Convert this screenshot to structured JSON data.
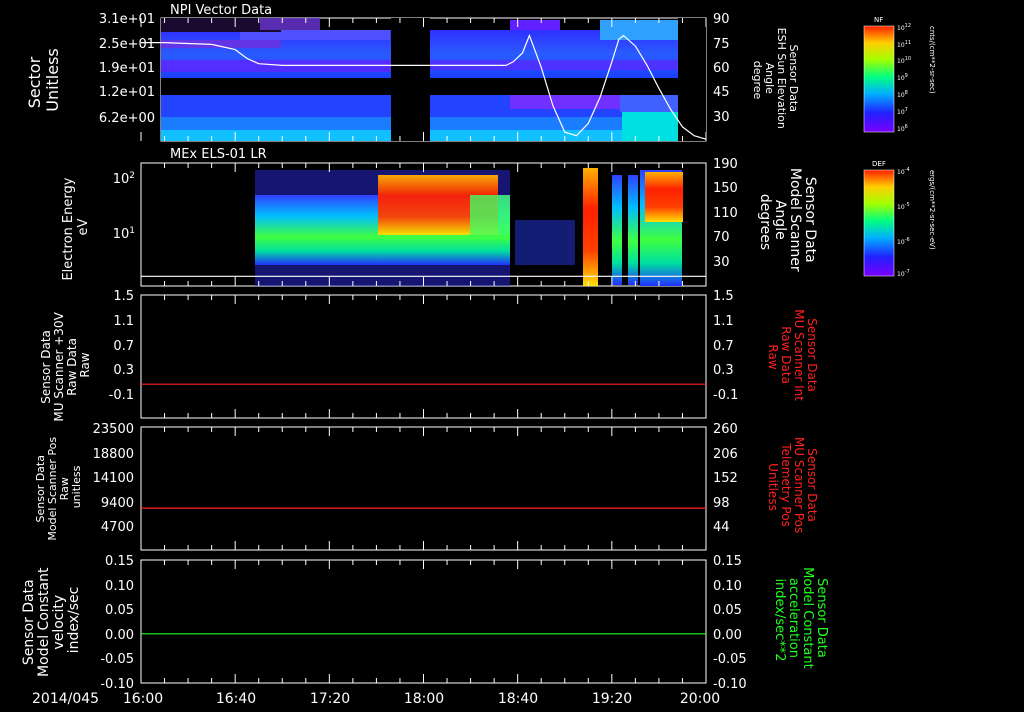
{
  "time_axis": {
    "date_label": "2014/045",
    "ticks": [
      "16:00",
      "16:40",
      "17:20",
      "18:00",
      "18:40",
      "19:20",
      "20:00"
    ]
  },
  "chart_data": [
    {
      "type": "heatmap",
      "title": "NPI Vector Data",
      "ylabel": [
        "Sector",
        "Unitless"
      ],
      "yticks": [
        "3.1e+01",
        "2.5e+01",
        "1.9e+01",
        "1.2e+01",
        "6.2e+00"
      ],
      "right_ylabel": [
        "Sensor Data",
        "ESH Sun Elevation",
        "Angle",
        "degree"
      ],
      "right_yticks": [
        "90",
        "75",
        "60",
        "45",
        "30"
      ],
      "right_ylim": [
        20,
        90
      ],
      "colorbar": {
        "label": "NF",
        "unit": "cnts/(cm**2-sr-sec)",
        "ticks": [
          "10^12",
          "10^11",
          "10^10",
          "10^9",
          "10^8",
          "10^7",
          "10^6"
        ]
      },
      "overlay_line": {
        "color": "#ffffff",
        "x": [
          "16:00",
          "16:10",
          "16:20",
          "16:30",
          "16:40",
          "16:45",
          "16:50",
          "17:00",
          "17:20",
          "17:40",
          "18:00",
          "18:20",
          "18:35",
          "18:38",
          "18:42",
          "18:45",
          "18:50",
          "18:55",
          "19:00",
          "19:05",
          "19:10",
          "19:15",
          "19:20",
          "19:23",
          "19:25",
          "19:30",
          "19:35",
          "19:40",
          "19:45",
          "19:50",
          "19:55",
          "20:00"
        ],
        "values": [
          76,
          76,
          75.5,
          75,
          72,
          67,
          64,
          63,
          63,
          63,
          63,
          63,
          63,
          65,
          70,
          80,
          62,
          40,
          25,
          23,
          30,
          45,
          65,
          78,
          80,
          74,
          63,
          50,
          38,
          28,
          23,
          21
        ]
      }
    },
    {
      "type": "heatmap",
      "title": "MEx ELS-01 LR",
      "ylabel": [
        "Electron Energy",
        "eV"
      ],
      "yticks": [
        "10^2",
        "10^1"
      ],
      "right_ylabel": [
        "Sensor Data",
        "Model Scanner",
        "Angle",
        "degrees"
      ],
      "right_yticks": [
        "190",
        "150",
        "110",
        "70",
        "30"
      ],
      "right_ylim": [
        0,
        190
      ],
      "colorbar": {
        "label": "DEF",
        "unit": "ergs/(cm**2-sr-sec-eV)",
        "ticks": [
          "10^-4",
          "10^-5",
          "10^-6",
          "10^-7"
        ]
      },
      "overlay_line": {
        "color": "#ffffff",
        "x": [
          "16:00",
          "20:00"
        ],
        "values": [
          15,
          15
        ]
      }
    },
    {
      "type": "line",
      "ylabel": [
        "Sensor Data",
        "MU Scanner +30V",
        "Raw Data",
        "Raw"
      ],
      "yticks": [
        "1.5",
        "1.1",
        "0.7",
        "0.3",
        "-0.1"
      ],
      "ylim": [
        -0.5,
        1.5
      ],
      "right_ylabel": [
        "Sensor Data",
        "MU Scanner Int",
        "Raw Data",
        "Raw"
      ],
      "right_yticks": [
        "1.5",
        "1.1",
        "0.7",
        "0.3",
        "-0.1"
      ],
      "series": [
        {
          "color": "#ff2020",
          "x": [
            "16:00",
            "20:00"
          ],
          "values": [
            0.05,
            0.05
          ]
        }
      ]
    },
    {
      "type": "line",
      "ylabel": [
        "Sensor Data",
        "Model Scanner Pos",
        "Raw",
        "unitless"
      ],
      "yticks": [
        "23500",
        "18800",
        "14100",
        "9400",
        "4700"
      ],
      "ylim": [
        0,
        23500
      ],
      "right_ylabel": [
        "Sensor Data",
        "MU Scanner Pos",
        "Telemetry Pos",
        "Unitless"
      ],
      "right_yticks": [
        "260",
        "206",
        "152",
        "98",
        "44"
      ],
      "series": [
        {
          "color": "#ff2020",
          "x": [
            "16:00",
            "20:00"
          ],
          "values": [
            8000,
            8000
          ]
        }
      ]
    },
    {
      "type": "line",
      "ylabel": [
        "Sensor Data",
        "Model Constant",
        "velocity",
        "index/sec"
      ],
      "yticks": [
        "0.15",
        "0.10",
        "0.05",
        "0.00",
        "-0.05",
        "-0.10"
      ],
      "ylim": [
        -0.1,
        0.15
      ],
      "right_ylabel": [
        "Sensor Data",
        "Model Constant",
        "acceleration",
        "index/sec**2"
      ],
      "right_yticks": [
        "0.15",
        "0.10",
        "0.05",
        "0.00",
        "-0.05",
        "-0.10"
      ],
      "series": [
        {
          "color": "#20ff20",
          "x": [
            "16:00",
            "20:00"
          ],
          "values": [
            0.0,
            0.0
          ]
        }
      ]
    }
  ]
}
